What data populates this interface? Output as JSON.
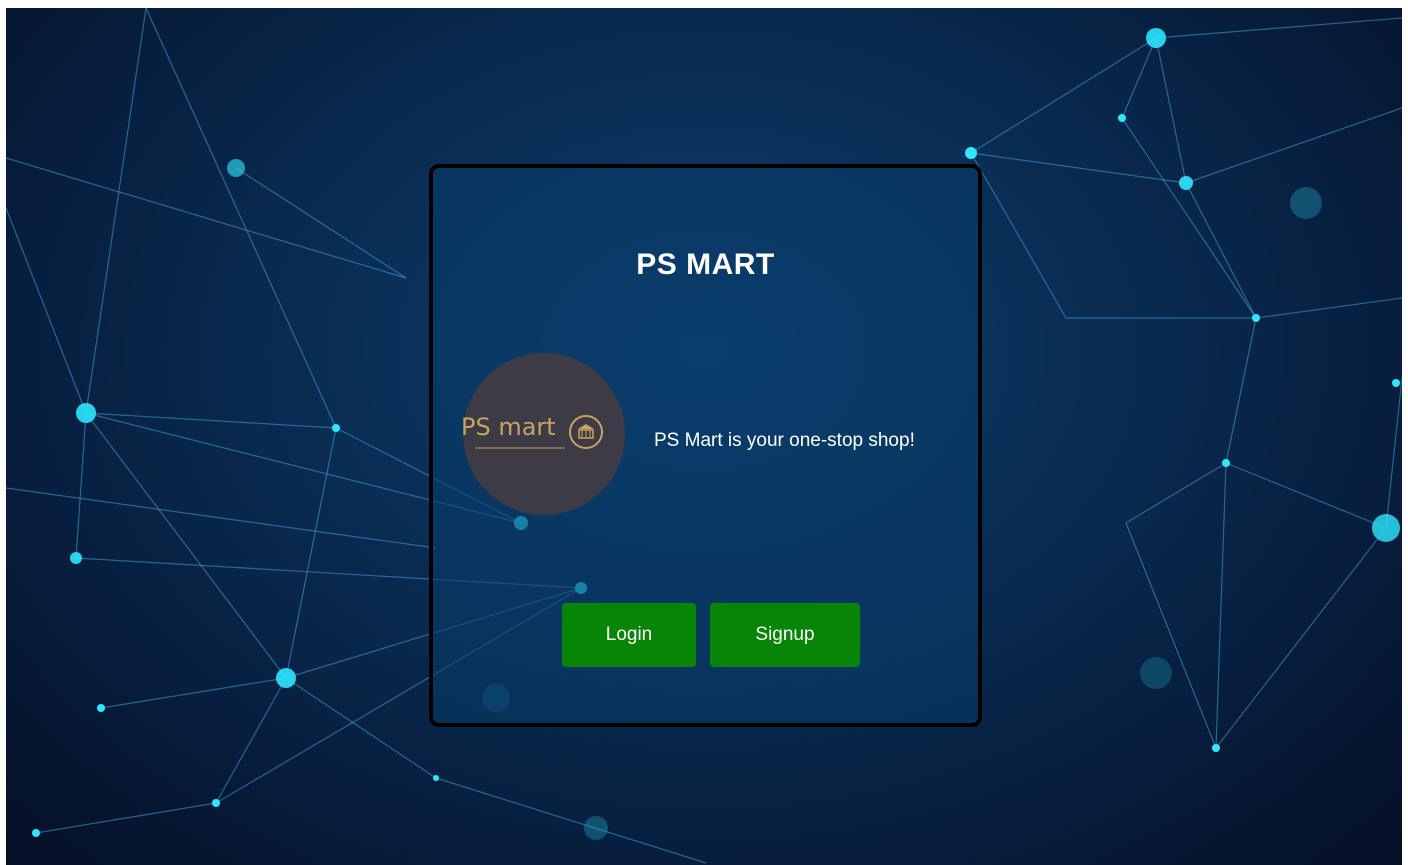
{
  "card": {
    "title": "PS MART",
    "tagline": "PS Mart is your one-stop shop!",
    "logo": {
      "text": "PS mart",
      "icon": "store-icon",
      "colors": {
        "background": "#3d3b45",
        "gold": "#c9a262"
      }
    },
    "buttons": {
      "login_label": "Login",
      "signup_label": "Signup"
    }
  },
  "colors": {
    "button": "#078507",
    "background": "#0a2f57",
    "card_border": "#000000",
    "network_glow": "#22d3f0"
  }
}
